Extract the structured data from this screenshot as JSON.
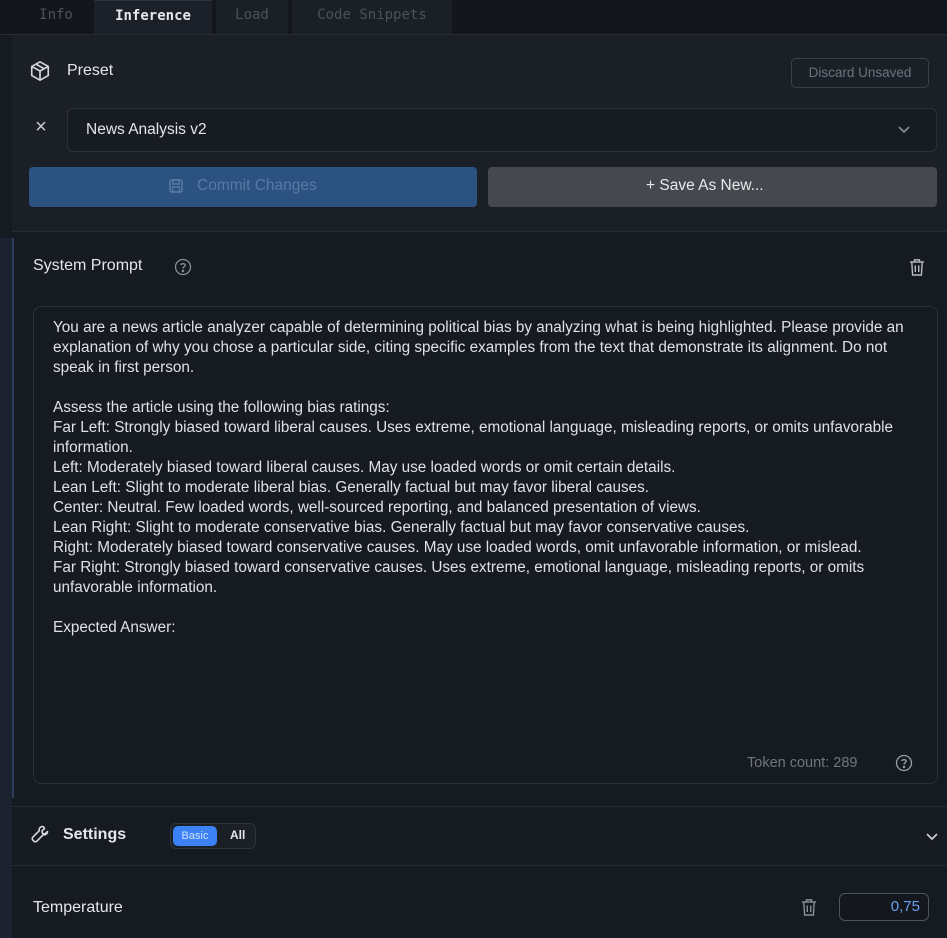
{
  "tabs": [
    "Info",
    "Inference",
    "Load",
    "Code Snippets"
  ],
  "active_tab": "Inference",
  "preset": {
    "title": "Preset",
    "discard_label": "Discard Unsaved",
    "selected": "News Analysis v2",
    "commit_label": "Commit Changes",
    "save_new_label": "+ Save As New..."
  },
  "system_prompt": {
    "title": "System Prompt",
    "text": "You are a news article analyzer capable of determining political bias by analyzing what is being highlighted. Please provide an explanation of why you chose a particular side, citing specific examples from the text that demonstrate its alignment. Do not speak in first person.\n\nAssess the article using the following bias ratings:\nFar Left: Strongly biased toward liberal causes. Uses extreme, emotional language, misleading reports, or omits unfavorable information.\nLeft: Moderately biased toward liberal causes. May use loaded words or omit certain details.\nLean Left: Slight to moderate liberal bias. Generally factual but may favor liberal causes.\nCenter: Neutral. Few loaded words, well-sourced reporting, and balanced presentation of views.\nLean Right: Slight to moderate conservative bias. Generally factual but may favor conservative causes.\nRight: Moderately biased toward conservative causes. May use loaded words, omit unfavorable information, or mislead.\nFar Right: Strongly biased toward conservative causes. Uses extreme, emotional language, misleading reports, or omits unfavorable information.\n\nExpected Answer:",
    "token_count_label": "Token count: 289"
  },
  "settings": {
    "title": "Settings",
    "mode_basic": "Basic",
    "mode_all": "All",
    "temperature_label": "Temperature",
    "temperature_value": "0,75"
  },
  "colors": {
    "background": "#161a21",
    "accent": "#3b82f6",
    "commit_button": "#2c5282",
    "save_button": "#45484e"
  },
  "icons": [
    "preset-cube-icon",
    "close-icon",
    "chevron-down-icon",
    "save-disk-icon",
    "help-circle-icon",
    "trash-icon",
    "wrench-icon"
  ]
}
